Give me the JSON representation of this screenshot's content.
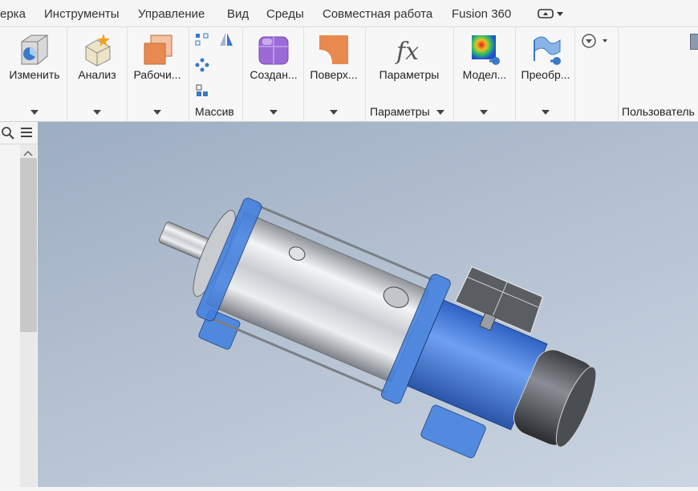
{
  "menubar": {
    "items": [
      "ерка",
      "Инструменты",
      "Управление",
      "Вид",
      "Среды",
      "Совместная работа",
      "Fusion 360"
    ]
  },
  "ribbon": {
    "buttons": [
      {
        "label": "Изменить",
        "icon": "modify-cube-icon"
      },
      {
        "label": "Анализ",
        "icon": "analysis-box-icon"
      },
      {
        "label": "Рабочи...",
        "icon": "work-plane-icon"
      },
      {
        "label": "Создан...",
        "icon": "create-solid-icon"
      },
      {
        "label": "Поверх...",
        "icon": "surface-icon"
      },
      {
        "label": "Параметры",
        "icon": "fx-parameters-icon"
      },
      {
        "label": "Модел...",
        "icon": "simulation-model-icon"
      },
      {
        "label": "Преобр...",
        "icon": "convert-icon"
      }
    ],
    "groups": {
      "pattern": "Массив",
      "parameters": "Параметры",
      "user": "Пользователь"
    }
  },
  "colors": {
    "accent_orange": "#e8894f",
    "accent_purple": "#9b6ad6",
    "model_blue": "#3f7fe0"
  }
}
